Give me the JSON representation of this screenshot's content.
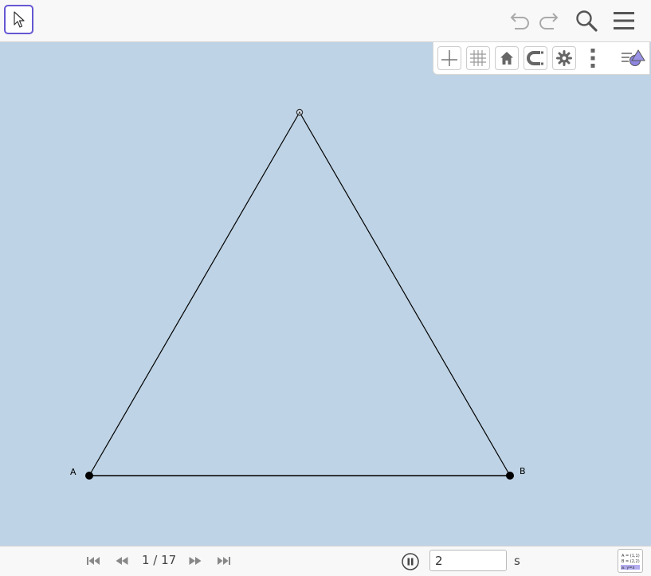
{
  "toolbar": {
    "move_tool": "move-tool",
    "undo": "undo",
    "redo": "redo",
    "search": "search",
    "menu": "menu"
  },
  "style_bar": {
    "items": [
      "axes",
      "grid",
      "standard-view",
      "point-capturing",
      "settings",
      "more",
      "toggle-style-bar"
    ]
  },
  "graphics": {
    "background": "#bed3e5",
    "points": [
      {
        "name": "A",
        "label": "A",
        "x": 1,
        "y": 1
      },
      {
        "name": "B",
        "label": "B",
        "x": 2,
        "y": 2
      }
    ]
  },
  "bottom": {
    "page_counter": "1 / 17",
    "speed_value": "2",
    "speed_unit": "s",
    "algebra_lines": [
      "A = (1,1)",
      "B = (2,2)",
      "a: y=x"
    ]
  },
  "colors": {
    "accent": "#6557d2",
    "canvas": "#bed3e5",
    "icon": "#666666"
  }
}
